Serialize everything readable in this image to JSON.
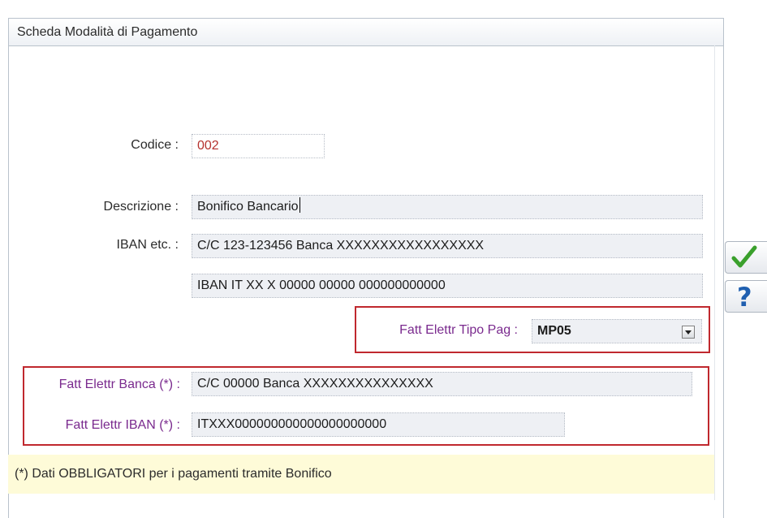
{
  "window": {
    "title": "Scheda Modalità di Pagamento"
  },
  "form": {
    "codice": {
      "label": "Codice :",
      "value": "002"
    },
    "descrizione": {
      "label": "Descrizione :",
      "value": "Bonifico Bancario"
    },
    "iban_etc": {
      "label": "IBAN etc. :",
      "value1": "C/C 123-123456 Banca XXXXXXXXXXXXXXXXX",
      "value2": "IBAN IT XX X 00000 00000 000000000000"
    },
    "tipo_pag": {
      "label": "Fatt Elettr Tipo Pag :",
      "value": "MP05"
    },
    "banca": {
      "label": "Fatt Elettr Banca (*) :",
      "value": "C/C 00000 Banca XXXXXXXXXXXXXXX"
    },
    "iban_fe": {
      "label": "Fatt Elettr IBAN (*) :",
      "value": "ITXXX000000000000000000000"
    }
  },
  "note": "(*) Dati OBBLIGATORI per i pagamenti tramite Bonifico",
  "colors": {
    "required_label": "#7a2a8e",
    "highlight_border": "#c0282e",
    "confirm": "#3aa02c",
    "help": "#1f5fb0"
  }
}
